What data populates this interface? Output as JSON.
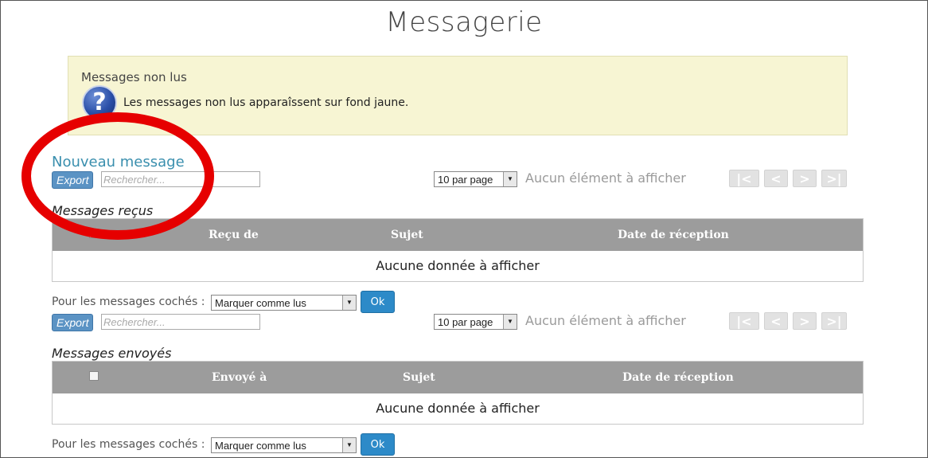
{
  "page": {
    "title": "Messagerie"
  },
  "info_box": {
    "title": "Messages non lus",
    "icon": "question-icon",
    "icon_glyph": "?",
    "text": "Les messages non lus apparaîssent sur fond jaune."
  },
  "new_message_link": "Nouveau message",
  "received": {
    "toolbar": {
      "export_label": "Export",
      "search_placeholder": "Rechercher...",
      "per_page": "10 par page",
      "empty_info": "Aucun élément à afficher",
      "pager": [
        "|<",
        "<",
        ">",
        ">|"
      ]
    },
    "section_title": "Messages reçus",
    "columns": [
      "Reçu de",
      "Sujet",
      "Date de réception"
    ],
    "empty_row": "Aucune donnée à afficher",
    "bulk": {
      "label": "Pour les messages cochés :",
      "action": "Marquer comme lus",
      "ok": "Ok"
    }
  },
  "sent": {
    "toolbar": {
      "export_label": "Export",
      "search_placeholder": "Rechercher...",
      "per_page": "10 par page",
      "empty_info": "Aucun élément à afficher",
      "pager": [
        "|<",
        "<",
        ">",
        ">|"
      ]
    },
    "section_title": "Messages envoyés",
    "columns": [
      "Envoyé à",
      "Sujet",
      "Date de réception"
    ],
    "empty_row": "Aucune donnée à afficher",
    "bulk": {
      "label": "Pour les messages cochés :",
      "action": "Marquer comme lus",
      "ok": "Ok"
    }
  },
  "colors": {
    "header_gray": "#9c9c9c",
    "info_bg": "#f7f5d3",
    "link_teal": "#3a8fae",
    "ok_blue": "#2d8ac8",
    "annotation_red": "#e60000"
  }
}
